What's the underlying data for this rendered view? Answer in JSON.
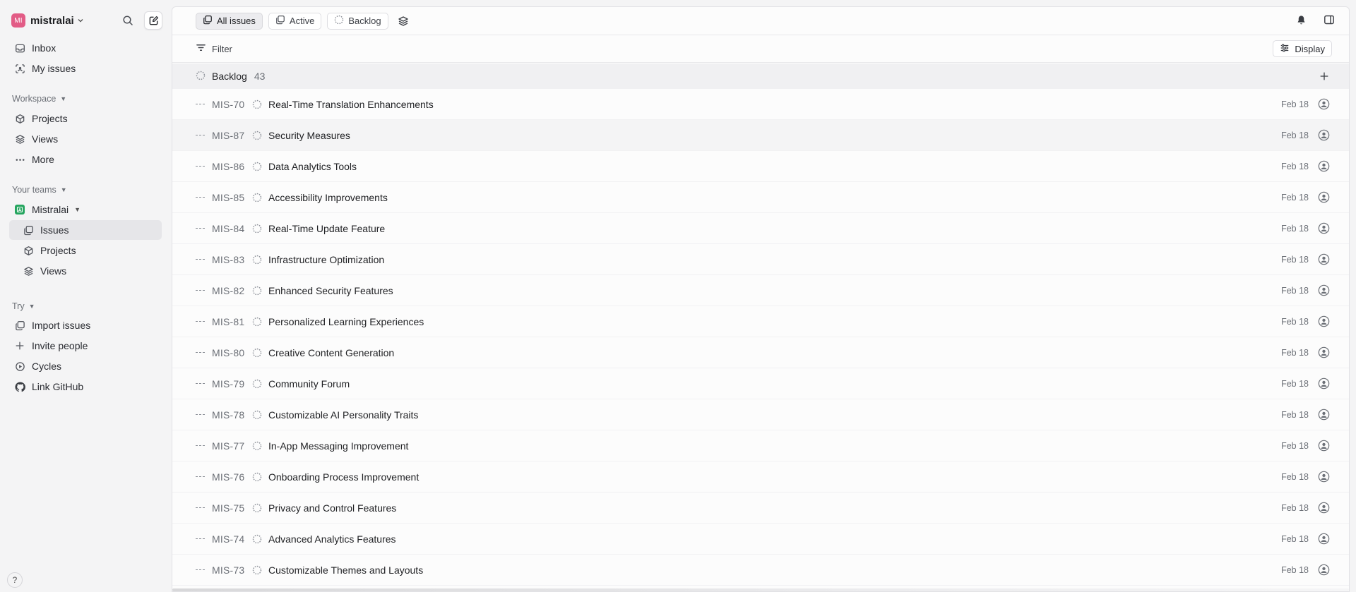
{
  "workspace": {
    "avatar_initials": "MI",
    "name": "mistralai",
    "avatar_color": "#e25c86"
  },
  "sidebar": {
    "top_items": [
      {
        "label": "Inbox",
        "icon": "inbox-icon"
      },
      {
        "label": "My issues",
        "icon": "my-issues-icon"
      }
    ],
    "workspace_label": "Workspace",
    "workspace_items": [
      {
        "label": "Projects",
        "icon": "cube-icon"
      },
      {
        "label": "Views",
        "icon": "layers-icon"
      },
      {
        "label": "More",
        "icon": "more-dots-icon"
      }
    ],
    "teams_label": "Your teams",
    "team": {
      "name": "Mistralai",
      "color": "#25a55f"
    },
    "team_items": [
      {
        "label": "Issues",
        "icon": "issues-icon",
        "active": true
      },
      {
        "label": "Projects",
        "icon": "cube-icon"
      },
      {
        "label": "Views",
        "icon": "layers-icon"
      }
    ],
    "try_label": "Try",
    "try_items": [
      {
        "label": "Import issues",
        "icon": "import-icon"
      },
      {
        "label": "Invite people",
        "icon": "plus-icon"
      },
      {
        "label": "Cycles",
        "icon": "cycles-icon"
      },
      {
        "label": "Link GitHub",
        "icon": "github-icon"
      }
    ],
    "help_label": "?"
  },
  "toolbar": {
    "tabs": [
      {
        "label": "All issues",
        "active": true
      },
      {
        "label": "Active",
        "active": false
      },
      {
        "label": "Backlog",
        "active": false
      }
    ],
    "filter_label": "Filter",
    "display_label": "Display"
  },
  "group": {
    "name": "Backlog",
    "count": "43"
  },
  "issues": [
    {
      "id": "MIS-70",
      "title": "Real-Time Translation Enhancements",
      "date": "Feb 18"
    },
    {
      "id": "MIS-87",
      "title": "Security Measures",
      "date": "Feb 18"
    },
    {
      "id": "MIS-86",
      "title": "Data Analytics Tools",
      "date": "Feb 18"
    },
    {
      "id": "MIS-85",
      "title": "Accessibility Improvements",
      "date": "Feb 18"
    },
    {
      "id": "MIS-84",
      "title": "Real-Time Update Feature",
      "date": "Feb 18"
    },
    {
      "id": "MIS-83",
      "title": "Infrastructure Optimization",
      "date": "Feb 18"
    },
    {
      "id": "MIS-82",
      "title": "Enhanced Security Features",
      "date": "Feb 18"
    },
    {
      "id": "MIS-81",
      "title": "Personalized Learning Experiences",
      "date": "Feb 18"
    },
    {
      "id": "MIS-80",
      "title": "Creative Content Generation",
      "date": "Feb 18"
    },
    {
      "id": "MIS-79",
      "title": "Community Forum",
      "date": "Feb 18"
    },
    {
      "id": "MIS-78",
      "title": "Customizable AI Personality Traits",
      "date": "Feb 18"
    },
    {
      "id": "MIS-77",
      "title": "In-App Messaging Improvement",
      "date": "Feb 18"
    },
    {
      "id": "MIS-76",
      "title": "Onboarding Process Improvement",
      "date": "Feb 18"
    },
    {
      "id": "MIS-75",
      "title": "Privacy and Control Features",
      "date": "Feb 18"
    },
    {
      "id": "MIS-74",
      "title": "Advanced Analytics Features",
      "date": "Feb 18"
    },
    {
      "id": "MIS-73",
      "title": "Customizable Themes and Layouts",
      "date": "Feb 18"
    }
  ]
}
